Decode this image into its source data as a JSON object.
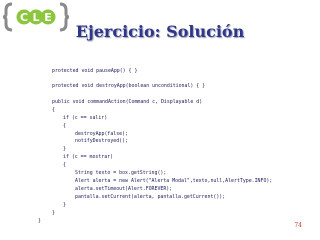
{
  "logo": {
    "text": "CLE"
  },
  "slide": {
    "title": "Ejercicio: Solución",
    "page_number": "74"
  },
  "code": {
    "lines": [
      "protected void pauseApp() { }",
      "protected void destroyApp(boolean unconditional) { }",
      "public void commandAction(Command c, Displayable d)",
      "{",
      "if (c == salir)",
      "{",
      "destroyApp(false);",
      "notifyDestroyed();",
      "}",
      "if (c == mostrar)",
      "{",
      "String texto = box.getString();",
      "Alert alerta = new Alert(\"Alerta Modal\",texto,null,AlertType.INFO);",
      "alerta.setTimeout(Alert.FOREVER);",
      "pantalla.setCurrent(alerta, pantalla.getCurrent());",
      "}",
      "}",
      "}"
    ]
  }
}
